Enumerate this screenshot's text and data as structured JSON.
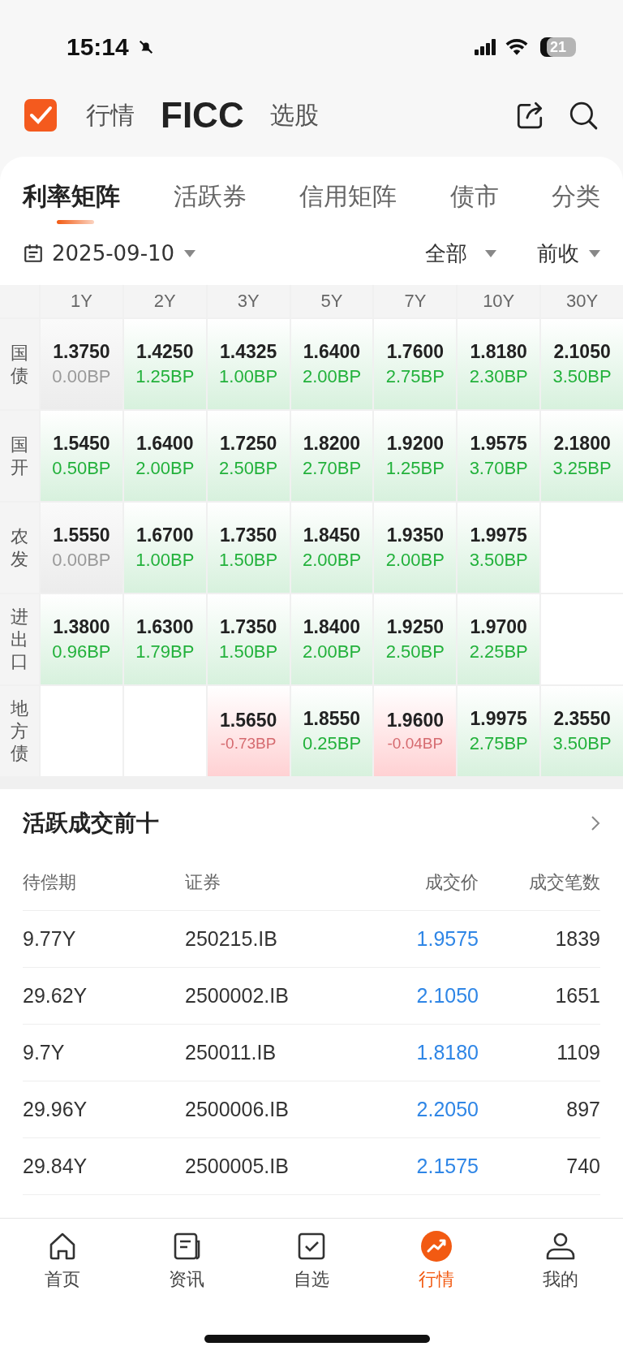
{
  "status_bar": {
    "time": "15:14",
    "battery": "21"
  },
  "header": {
    "tabs": [
      {
        "label": "行情",
        "selected": false
      },
      {
        "label": "FICC",
        "selected": true
      },
      {
        "label": "选股",
        "selected": false
      }
    ]
  },
  "sub_tabs": [
    {
      "label": "利率矩阵",
      "selected": true
    },
    {
      "label": "活跃券",
      "selected": false
    },
    {
      "label": "信用矩阵",
      "selected": false
    },
    {
      "label": "债市",
      "selected": false
    },
    {
      "label": "分类",
      "selected": false
    }
  ],
  "filters": {
    "date": "2025-09-10",
    "scope": "全部",
    "basis": "前收"
  },
  "matrix": {
    "columns": [
      "1Y",
      "2Y",
      "3Y",
      "5Y",
      "7Y",
      "10Y",
      "30Y"
    ],
    "rows": [
      {
        "label": "国债",
        "cells": [
          {
            "yield": "1.3750",
            "change": "0.00BP",
            "kind": "flat"
          },
          {
            "yield": "1.4250",
            "change": "1.25BP",
            "kind": "up"
          },
          {
            "yield": "1.4325",
            "change": "1.00BP",
            "kind": "up"
          },
          {
            "yield": "1.6400",
            "change": "2.00BP",
            "kind": "up"
          },
          {
            "yield": "1.7600",
            "change": "2.75BP",
            "kind": "up"
          },
          {
            "yield": "1.8180",
            "change": "2.30BP",
            "kind": "up"
          },
          {
            "yield": "2.1050",
            "change": "3.50BP",
            "kind": "up"
          }
        ]
      },
      {
        "label": "国开",
        "cells": [
          {
            "yield": "1.5450",
            "change": "0.50BP",
            "kind": "up"
          },
          {
            "yield": "1.6400",
            "change": "2.00BP",
            "kind": "up"
          },
          {
            "yield": "1.7250",
            "change": "2.50BP",
            "kind": "up"
          },
          {
            "yield": "1.8200",
            "change": "2.70BP",
            "kind": "up"
          },
          {
            "yield": "1.9200",
            "change": "1.25BP",
            "kind": "up"
          },
          {
            "yield": "1.9575",
            "change": "3.70BP",
            "kind": "up"
          },
          {
            "yield": "2.1800",
            "change": "3.25BP",
            "kind": "up"
          }
        ]
      },
      {
        "label": "农发",
        "cells": [
          {
            "yield": "1.5550",
            "change": "0.00BP",
            "kind": "flat"
          },
          {
            "yield": "1.6700",
            "change": "1.00BP",
            "kind": "up"
          },
          {
            "yield": "1.7350",
            "change": "1.50BP",
            "kind": "up"
          },
          {
            "yield": "1.8450",
            "change": "2.00BP",
            "kind": "up"
          },
          {
            "yield": "1.9350",
            "change": "2.00BP",
            "kind": "up"
          },
          {
            "yield": "1.9975",
            "change": "3.50BP",
            "kind": "up"
          },
          null
        ]
      },
      {
        "label": "进出口",
        "cells": [
          {
            "yield": "1.3800",
            "change": "0.96BP",
            "kind": "up"
          },
          {
            "yield": "1.6300",
            "change": "1.79BP",
            "kind": "up"
          },
          {
            "yield": "1.7350",
            "change": "1.50BP",
            "kind": "up"
          },
          {
            "yield": "1.8400",
            "change": "2.00BP",
            "kind": "up"
          },
          {
            "yield": "1.9250",
            "change": "2.50BP",
            "kind": "up"
          },
          {
            "yield": "1.9700",
            "change": "2.25BP",
            "kind": "up"
          },
          null
        ]
      },
      {
        "label": "地方债",
        "cells": [
          null,
          null,
          {
            "yield": "1.5650",
            "change": "-0.73BP",
            "kind": "down"
          },
          {
            "yield": "1.8550",
            "change": "0.25BP",
            "kind": "up"
          },
          {
            "yield": "1.9600",
            "change": "-0.04BP",
            "kind": "down"
          },
          {
            "yield": "1.9975",
            "change": "2.75BP",
            "kind": "up"
          },
          {
            "yield": "2.3550",
            "change": "3.50BP",
            "kind": "up"
          }
        ]
      }
    ]
  },
  "active_trades": {
    "title": "活跃成交前十",
    "columns": [
      "待偿期",
      "证券",
      "成交价",
      "成交笔数"
    ],
    "rows": [
      {
        "term": "9.77Y",
        "security": "250215.IB",
        "price": "1.9575",
        "count": "1839"
      },
      {
        "term": "29.62Y",
        "security": "2500002.IB",
        "price": "2.1050",
        "count": "1651"
      },
      {
        "term": "9.7Y",
        "security": "250011.IB",
        "price": "1.8180",
        "count": "1109"
      },
      {
        "term": "29.96Y",
        "security": "2500006.IB",
        "price": "2.2050",
        "count": "897"
      },
      {
        "term": "29.84Y",
        "security": "2500005.IB",
        "price": "2.1575",
        "count": "740"
      }
    ]
  },
  "bottom_nav": [
    {
      "label": "首页",
      "kind": "home",
      "selected": false
    },
    {
      "label": "资讯",
      "kind": "news",
      "selected": false
    },
    {
      "label": "自选",
      "kind": "check",
      "selected": false
    },
    {
      "label": "行情",
      "kind": "chart",
      "selected": true
    },
    {
      "label": "我的",
      "kind": "user",
      "selected": false
    }
  ]
}
